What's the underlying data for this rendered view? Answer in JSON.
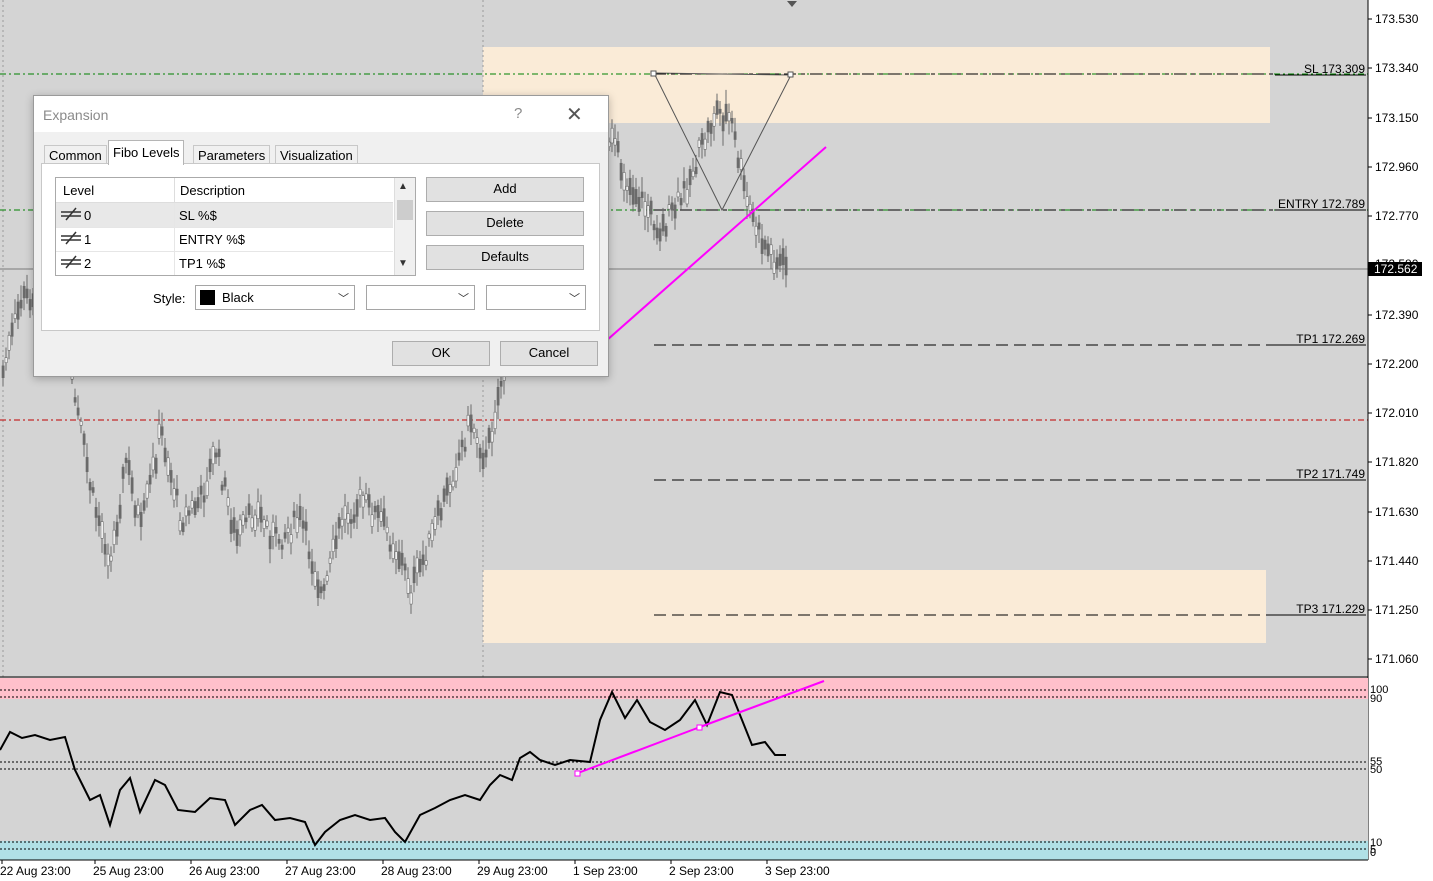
{
  "dialog": {
    "title": "Expansion",
    "help_label": "?",
    "close_label": "✕",
    "tabs": [
      {
        "label": "Common"
      },
      {
        "label": "Fibo Levels"
      },
      {
        "label": "Parameters"
      },
      {
        "label": "Visualization"
      }
    ],
    "levels": {
      "header_level": "Level",
      "header_description": "Description",
      "rows": [
        {
          "level": "0",
          "description": "SL  %$"
        },
        {
          "level": "1",
          "description": "ENTRY  %$"
        },
        {
          "level": "2",
          "description": "TP1  %$"
        }
      ]
    },
    "buttons": {
      "add": "Add",
      "delete": "Delete",
      "defaults": "Defaults",
      "ok": "OK",
      "cancel": "Cancel"
    },
    "style": {
      "label": "Style:",
      "color_name": "Black",
      "color_value": "#000000"
    }
  },
  "price_axis": {
    "labels": [
      "173.530",
      "173.340",
      "173.150",
      "172.960",
      "172.770",
      "172.390",
      "172.200",
      "172.010",
      "171.820",
      "171.630",
      "171.440",
      "171.250",
      "171.060"
    ],
    "current_price": "172.562",
    "partial_label": "172.580"
  },
  "level_labels": {
    "sl": "SL  173.309",
    "entry": "ENTRY  172.789",
    "tp1": "TP1  172.269",
    "tp2": "TP2  171.749",
    "tp3": "TP3  171.229"
  },
  "indicator_axis": {
    "top_label_a": "100",
    "top_label_b": "90",
    "mid_label_a": "55",
    "mid_label_b": "50",
    "low_label_a": "10",
    "low_label_b": "5",
    "low_label_c": "0"
  },
  "time_axis": {
    "labels": [
      "22 Aug 23:00",
      "25 Aug 23:00",
      "26 Aug 23:00",
      "27 Aug 23:00",
      "28 Aug 23:00",
      "29 Aug 23:00",
      "1 Sep 23:00",
      "2 Sep 23:00",
      "3 Sep 23:00"
    ]
  },
  "colors": {
    "background": "#d4d4d4",
    "zone": "#faebd7",
    "trendline": "#ff00ff",
    "overbought_band": "#ffc0cb",
    "oversold_band": "#b0e0e6",
    "candle": "#6b6b6b",
    "level_red": "#c00000",
    "level_green": "#008000"
  }
}
